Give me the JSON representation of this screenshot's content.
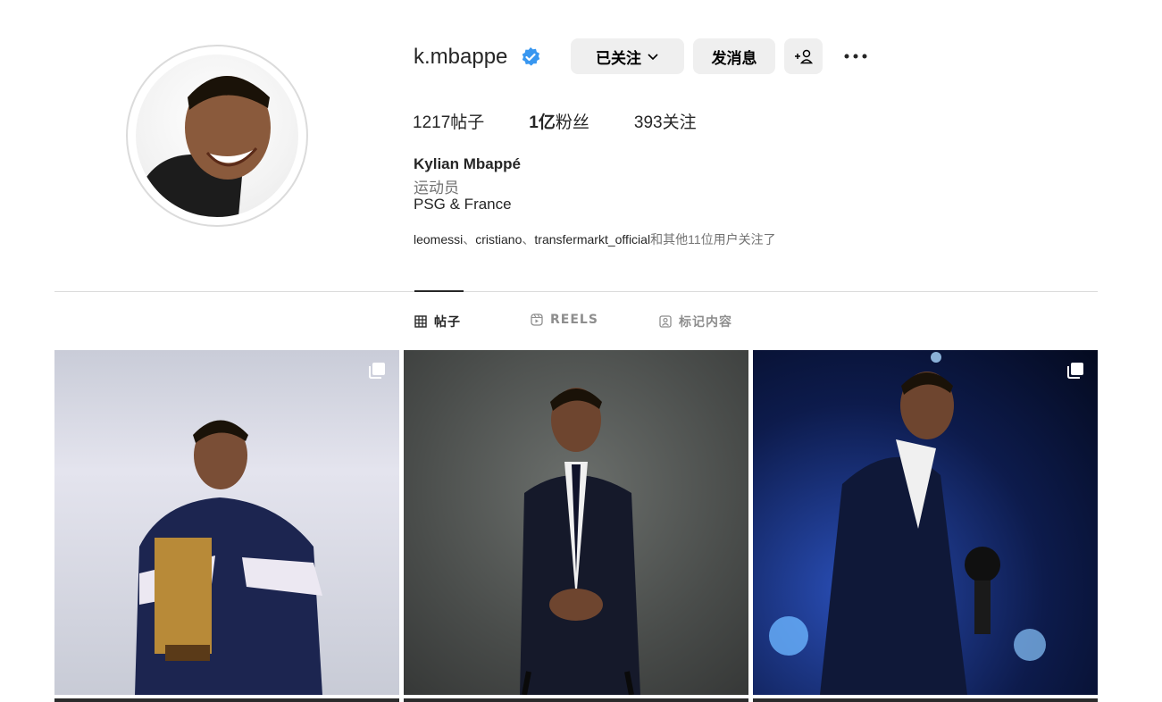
{
  "profile": {
    "username": "k.mbappe",
    "full_name": "Kylian Mbappé",
    "category": "运动员",
    "bio": "PSG & France",
    "avatar_icon": "profile-photo"
  },
  "actions": {
    "following_label": "已关注",
    "message_label": "发消息"
  },
  "stats": {
    "posts_value": "1217",
    "posts_label": "帖子",
    "followers_value": "1亿",
    "followers_label": "粉丝",
    "following_value": "393",
    "following_label": "关注"
  },
  "followed_by": {
    "accounts": [
      "leomessi",
      "cristiano",
      "transfermarkt_official"
    ],
    "separator": "、",
    "suffix": "和其他11位用户关注了"
  },
  "tabs": {
    "posts": "帖子",
    "reels": "REELS",
    "tagged": "标记内容"
  },
  "posts": [
    {
      "type": "carousel",
      "icon": "multiple-photos-icon"
    },
    {
      "type": "photo"
    },
    {
      "type": "carousel",
      "icon": "multiple-photos-icon"
    }
  ],
  "colors": {
    "verified": "#3897f0",
    "button_bg": "#efefef",
    "text_secondary": "#737373"
  }
}
